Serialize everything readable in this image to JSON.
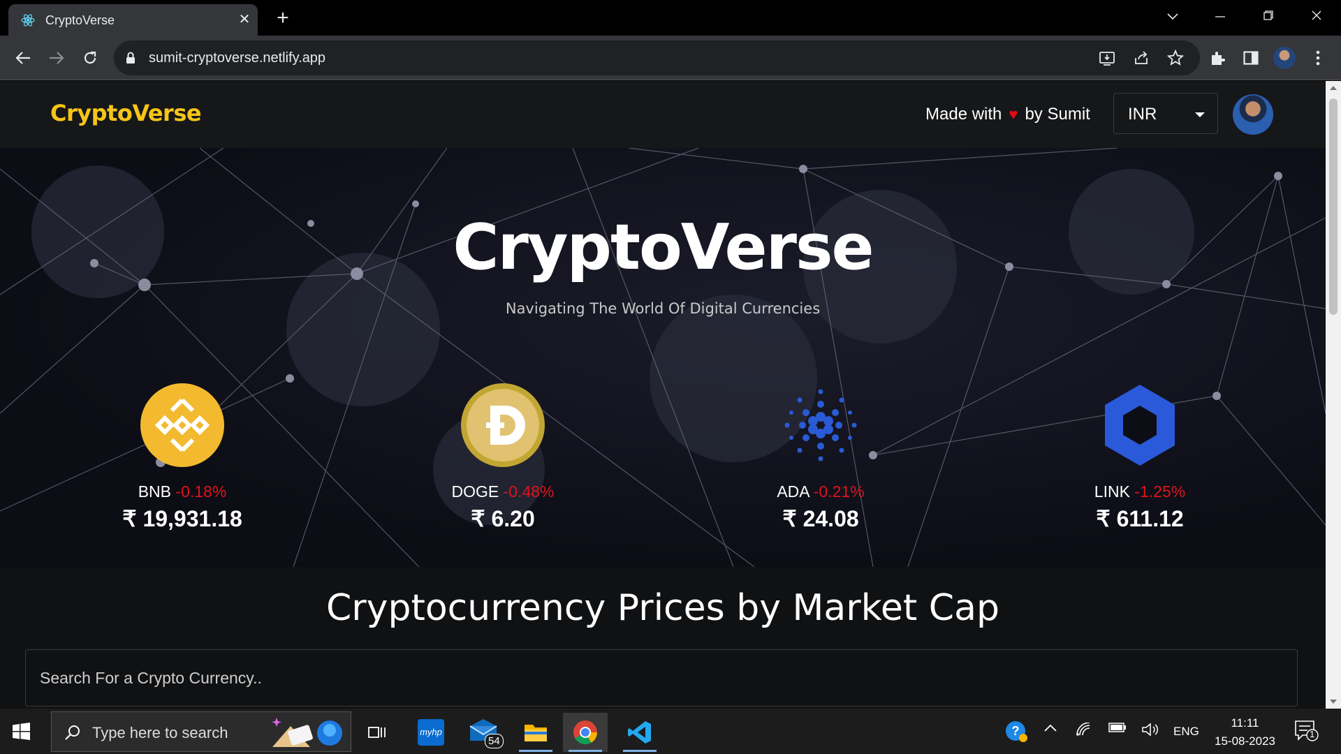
{
  "browser": {
    "tab_title": "CryptoVerse",
    "url": "sumit-cryptoverse.netlify.app"
  },
  "site": {
    "logo": "CryptoVerse",
    "made_with_prefix": "Made with",
    "made_with_suffix": "by Sumit",
    "currency_selected": "INR",
    "hero_title": "CryptoVerse",
    "hero_subtitle": "Navigating The World Of Digital Currencies",
    "coins": [
      {
        "symbol": "BNB",
        "change": "-0.18%",
        "price": "₹ 19,931.18",
        "icon": "bnb-logo",
        "color": "#f3ba2f"
      },
      {
        "symbol": "DOGE",
        "change": "-0.48%",
        "price": "₹ 6.20",
        "icon": "doge-logo",
        "color": "#c2a633"
      },
      {
        "symbol": "ADA",
        "change": "-0.21%",
        "price": "₹ 24.08",
        "icon": "ada-logo",
        "color": "#2a5bd7"
      },
      {
        "symbol": "LINK",
        "change": "-1.25%",
        "price": "₹ 611.12",
        "icon": "link-logo",
        "color": "#2a5ada"
      }
    ],
    "section_title": "Cryptocurrency Prices by Market Cap",
    "search_placeholder": "Search For a Crypto Currency.."
  },
  "taskbar": {
    "search_placeholder": "Type here to search",
    "mail_badge": "54",
    "language": "ENG",
    "time": "11:11",
    "date": "15-08-2023",
    "notification_count": "1"
  },
  "colors": {
    "accent": "#f5c518",
    "negative": "#e0131c",
    "heart": "#e50914"
  }
}
